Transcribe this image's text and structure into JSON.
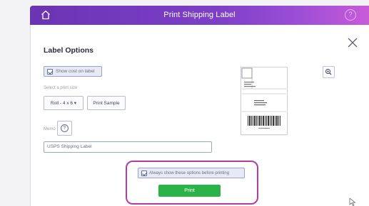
{
  "window": {
    "title": "Print Shipping Label",
    "home_icon": "home-icon",
    "help_icon": "help-icon",
    "help_glyph": "?",
    "close_icon": "close-icon"
  },
  "label_options": {
    "heading": "Label Options",
    "show_cost_label": "Show cost on label",
    "show_cost_checked": true,
    "print_size_label": "Select a print size",
    "print_size_value": "Roll - 4 x 6 ▾",
    "print_sample_label": "Print Sample",
    "memo_label": "Memo",
    "memo_help_glyph": "?",
    "memo_value": "USPS Shipping Label",
    "zoom_icon": "zoom-icon"
  },
  "footer": {
    "always_show_label": "Always show these options before printing",
    "always_show_checked": true,
    "print_button_label": "Print",
    "highlight_color": "#b53aa9",
    "print_button_color": "#2bb34a"
  },
  "theme": {
    "header_gradient_start": "#6a34b4",
    "header_gradient_end": "#c85bd8"
  }
}
